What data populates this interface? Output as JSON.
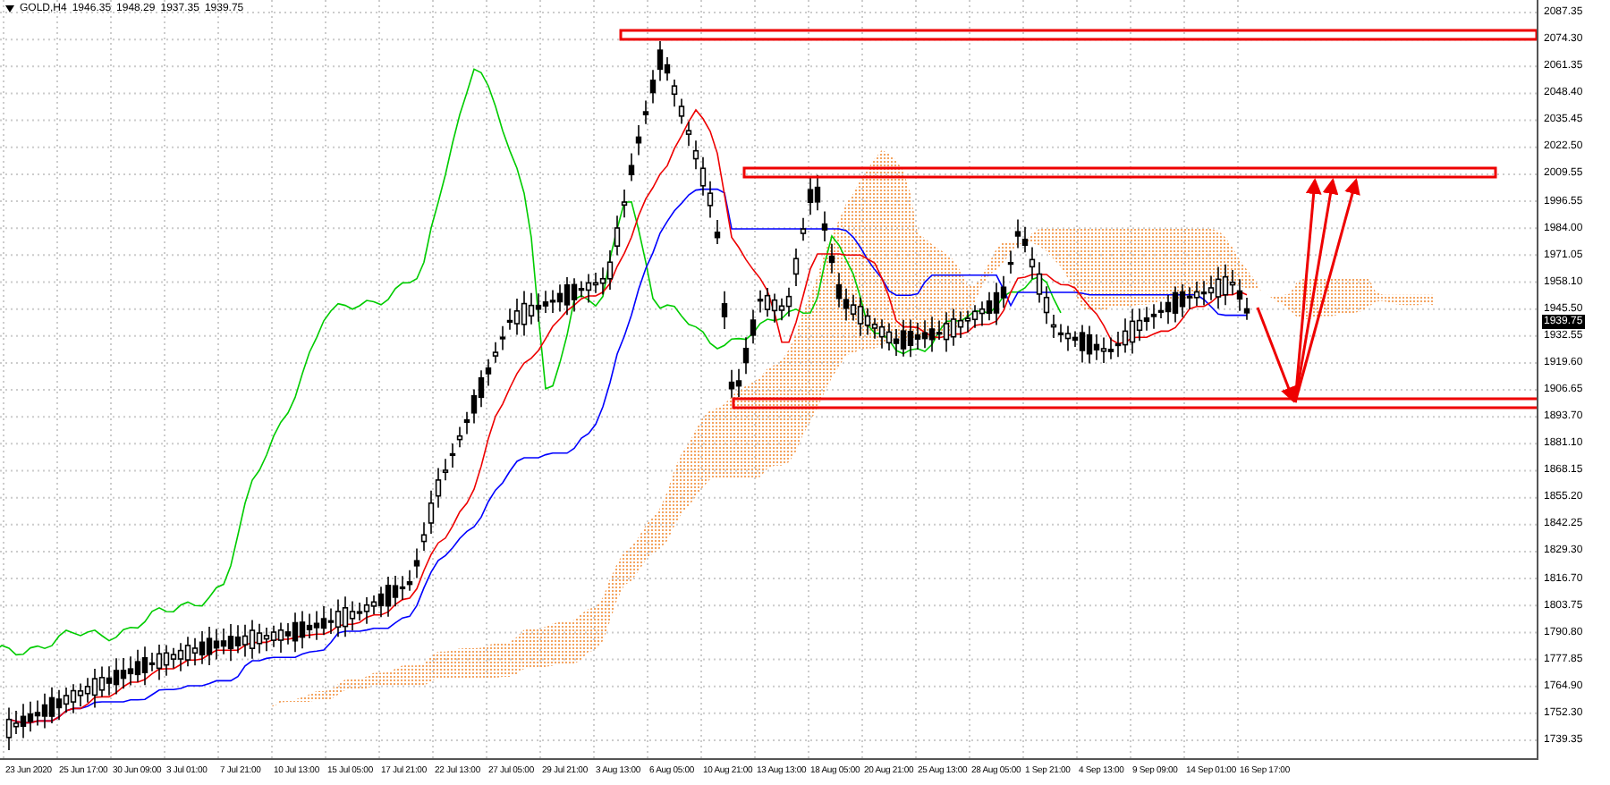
{
  "header": {
    "symbol": "GOLD,H4",
    "open": "1946.35",
    "high": "1948.29",
    "low": "1937.35",
    "close": "1939.75"
  },
  "price_axis": [
    "2087.35",
    "2074.30",
    "2061.35",
    "2048.40",
    "2035.45",
    "2022.50",
    "2009.55",
    "1996.55",
    "1984.00",
    "1971.05",
    "1958.10",
    "1945.50",
    "1932.55",
    "1919.60",
    "1906.65",
    "1893.70",
    "1881.10",
    "1868.15",
    "1855.20",
    "1842.25",
    "1829.30",
    "1816.70",
    "1803.75",
    "1790.80",
    "1777.85",
    "1764.90",
    "1752.30",
    "1739.35"
  ],
  "current_price": "1939.75",
  "time_axis": [
    "23 Jun 2020",
    "25 Jun 17:00",
    "30 Jun 09:00",
    "3 Jul 01:00",
    "7 Jul 21:00",
    "10 Jul 13:00",
    "15 Jul 05:00",
    "17 Jul 21:00",
    "22 Jul 13:00",
    "27 Jul 05:00",
    "29 Jul 21:00",
    "3 Aug 13:00",
    "6 Aug 05:00",
    "10 Aug 21:00",
    "13 Aug 13:00",
    "18 Aug 05:00",
    "20 Aug 21:00",
    "25 Aug 13:00",
    "28 Aug 05:00",
    "1 Sep 21:00",
    "4 Sep 13:00",
    "9 Sep 09:00",
    "14 Sep 01:00",
    "16 Sep 17:00"
  ]
}
